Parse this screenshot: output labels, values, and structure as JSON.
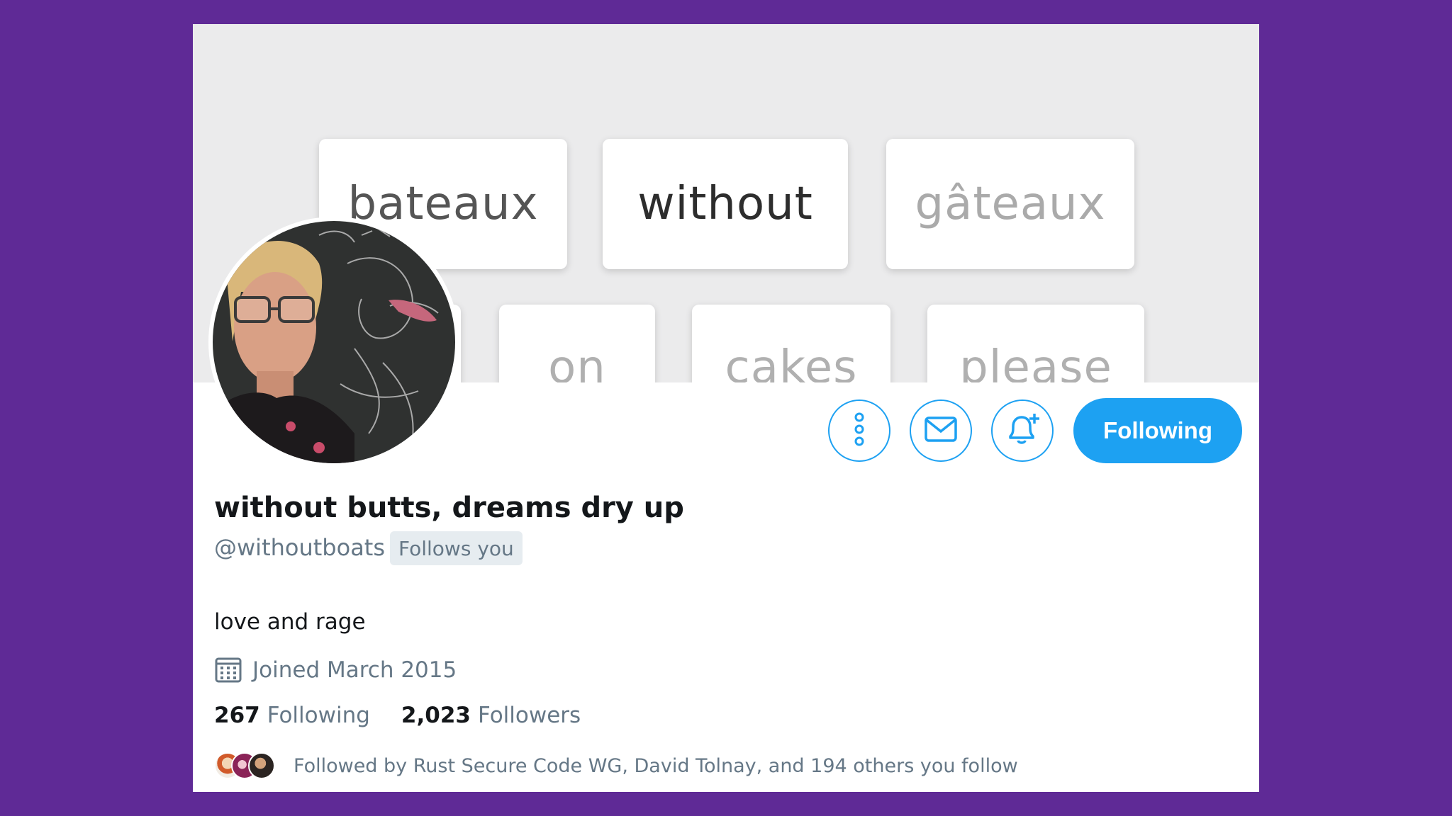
{
  "banner": {
    "tiles": [
      "bateaux",
      "without",
      "gâteaux",
      "on",
      "cakes",
      "please"
    ]
  },
  "actions": {
    "more_icon": "more-vertical-icon",
    "message_icon": "envelope-icon",
    "notify_icon": "bell-plus-icon",
    "follow_label": "Following"
  },
  "profile": {
    "display_name": "without butts, dreams dry up",
    "handle": "@withoutboats",
    "follows_you": "Follows you",
    "bio": "love and rage",
    "joined": "Joined March 2015",
    "following_count": "267",
    "following_label": "Following",
    "followers_count": "2,023",
    "followers_label": "Followers",
    "followed_by": "Followed by Rust Secure Code WG, David Tolnay, and 194 others you follow"
  },
  "colors": {
    "background": "#5f2a96",
    "accent": "#1da1f2",
    "secondary_text": "#657786"
  }
}
